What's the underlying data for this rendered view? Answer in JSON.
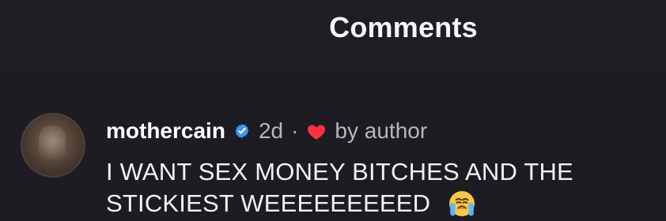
{
  "header": {
    "title": "Comments"
  },
  "comment": {
    "username": "mothercain",
    "time_ago": "2d",
    "separator": "·",
    "liked_by_author_label": "by author",
    "text_lines": [
      "I WANT SEX MONEY BITCHES AND THE",
      "STICKIEST WEEEEEEEEED"
    ]
  },
  "icons": {
    "verified_badge": "verified-badge-icon",
    "liked_by_author": "heart-icon",
    "emoji": "loudly-crying-face-icon"
  },
  "colors": {
    "background": "#1c1c22",
    "text_primary": "#ffffff",
    "text_muted": "#b6b6be",
    "verified_blue": "#3897f0",
    "heart_red": "#ff3040"
  }
}
